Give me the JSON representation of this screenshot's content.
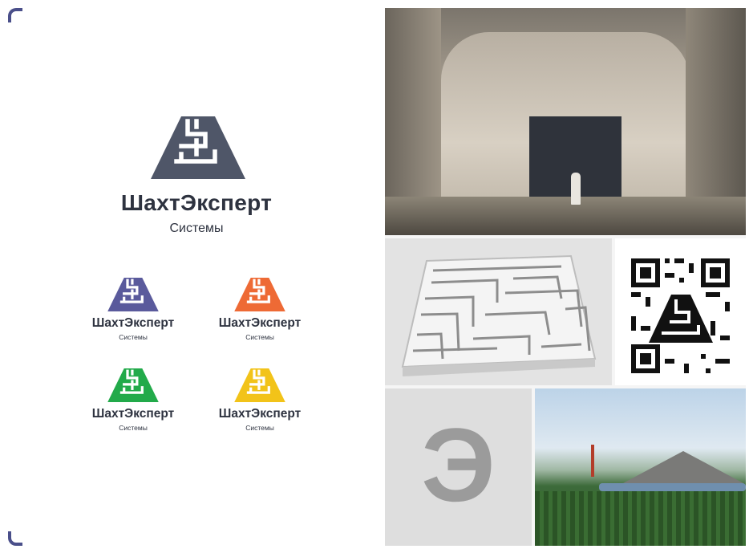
{
  "brand": {
    "name": "ШахтЭксперт",
    "subtitle": "Системы"
  },
  "variants": [
    {
      "name": "ШахтЭксперт",
      "subtitle": "Системы",
      "color": "#5a5a9c"
    },
    {
      "name": "ШахтЭксперт",
      "subtitle": "Системы",
      "color": "#ee6a35"
    },
    {
      "name": "ШахтЭксперт",
      "subtitle": "Системы",
      "color": "#22aa4a"
    },
    {
      "name": "ШахтЭксперт",
      "subtitle": "Системы",
      "color": "#f2c319"
    }
  ],
  "colors": {
    "primary_mark": "#4f5668",
    "text": "#2e3340",
    "corner_accent": "#4a4f8a",
    "letter_e": "#9b9b9b"
  },
  "tiles": {
    "letter": "Э"
  }
}
